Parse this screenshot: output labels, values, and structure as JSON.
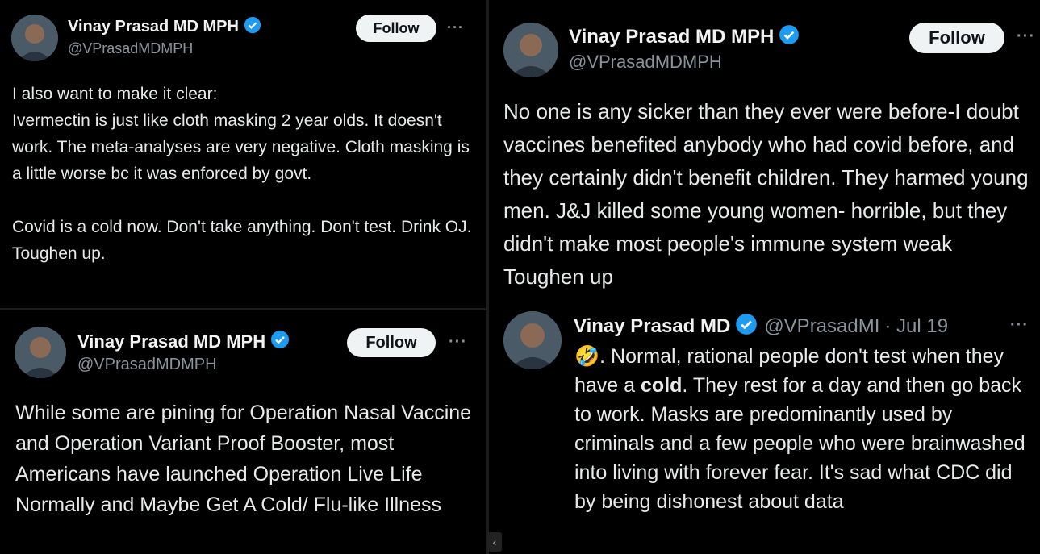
{
  "colors": {
    "background": "#000000",
    "verified": "#1d9bf0",
    "follow_bg": "#eff3f4",
    "muted": "#8b949b"
  },
  "tweet1": {
    "name": "Vinay Prasad MD MPH",
    "handle": "@VPrasadMDMPH",
    "follow_label": "Follow",
    "more": "···",
    "text": "I also want to make it clear:\nIvermectin is just like cloth masking 2 year olds. It doesn't work. The meta-analyses are very negative.  Cloth masking is a little worse bc it was enforced by govt.\n\nCovid is a cold now. Don't take anything. Don't test.  Drink OJ. Toughen up."
  },
  "tweet2": {
    "name": "Vinay Prasad MD MPH",
    "handle": "@VPrasadMDMPH",
    "follow_label": "Follow",
    "more": "···",
    "text": "While some are pining for Operation Nasal Vaccine and Operation Variant Proof Booster, most Americans have launched Operation Live Life Normally and Maybe Get A Cold/ Flu-like Illness"
  },
  "tweet3": {
    "name": "Vinay Prasad MD MPH",
    "handle": "@VPrasadMDMPH",
    "follow_label": "Follow",
    "more": "···",
    "text": "No one is any sicker than they ever were before-I doubt vaccines benefited anybody who had covid before, and they certainly didn't benefit children. They harmed young men. J&J killed some young women- horrible, but they didn't make most people's immune system weak Toughen up"
  },
  "tweet4": {
    "name": "Vinay Prasad MD",
    "handle": "@VPrasadMI",
    "date": "· Jul 19",
    "more": "···",
    "emoji": "🤣",
    "text_before_bold": ". Normal, rational people don't test when they have a ",
    "bold_word": "cold",
    "text_after_bold": ". They rest for a day and then go back to work.  Masks are predominantly used by criminals and a few people who were brainwashed into living with forever fear.  It's sad what CDC did by being dishonest about data"
  },
  "scroll_icon": "‹"
}
